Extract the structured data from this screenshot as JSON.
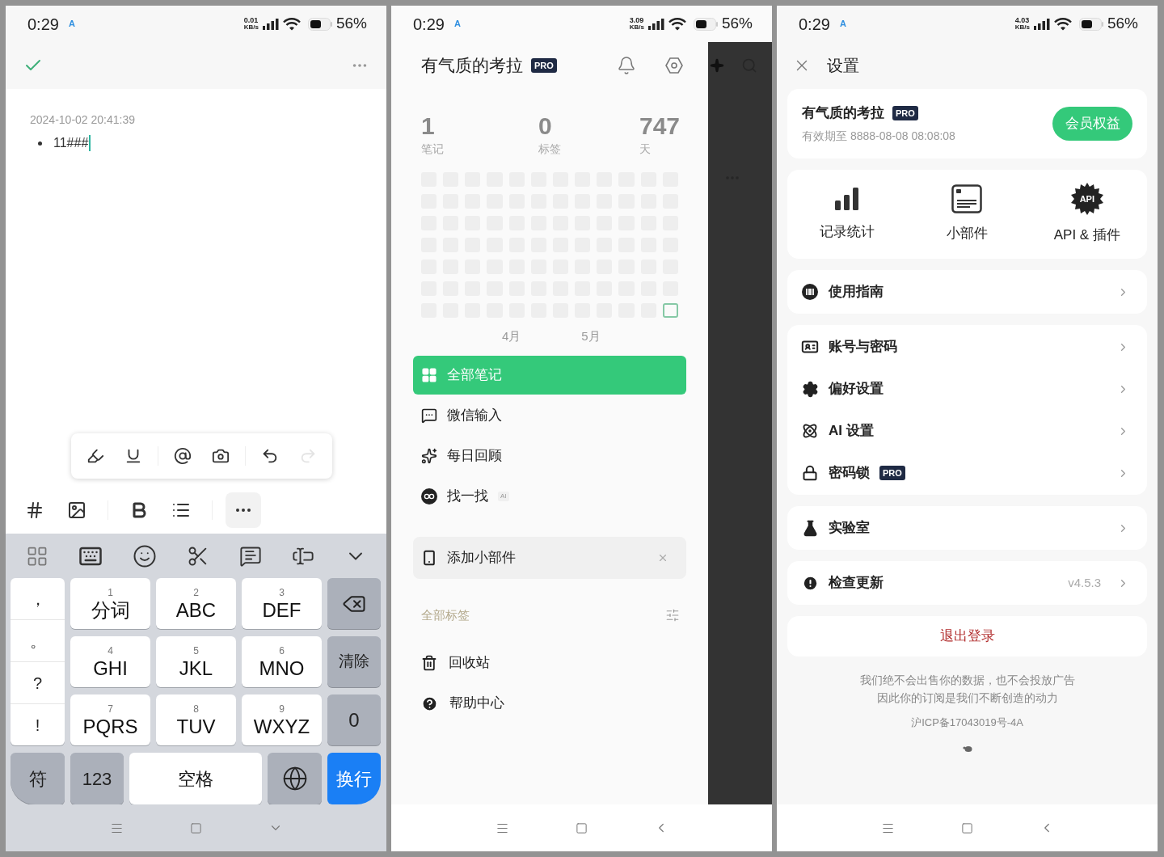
{
  "editor_screen": {
    "status_bar": {
      "time": "0:29",
      "notification": "A",
      "net_speed": "0.01",
      "net_unit": "KB/s",
      "battery": "56%"
    },
    "note": {
      "timestamp": "2024-10-02 20:41:39",
      "bullets": [
        "11###"
      ]
    },
    "floating_toolbar": [
      {
        "kind": "highlight",
        "disabled": false
      },
      {
        "kind": "underline",
        "disabled": false
      },
      {
        "kind": "mention",
        "disabled": false
      },
      {
        "kind": "camera",
        "disabled": false
      },
      {
        "kind": "undo",
        "disabled": false
      },
      {
        "kind": "redo",
        "disabled": true
      }
    ],
    "format_toolbar": [
      {
        "kind": "tag",
        "selected": false
      },
      {
        "kind": "image",
        "selected": false
      },
      {
        "kind": "bold",
        "selected": false
      },
      {
        "kind": "list",
        "selected": false
      },
      {
        "kind": "more",
        "selected": true
      }
    ],
    "keyboard": {
      "punctuation": [
        "，",
        "。",
        "?",
        "!"
      ],
      "keys": [
        {
          "digit": "1",
          "letters": "分词"
        },
        {
          "digit": "2",
          "letters": "ABC"
        },
        {
          "digit": "3",
          "letters": "DEF"
        },
        {
          "digit": "4",
          "letters": "GHI"
        },
        {
          "digit": "5",
          "letters": "JKL"
        },
        {
          "digit": "6",
          "letters": "MNO"
        },
        {
          "digit": "7",
          "letters": "PQRS"
        },
        {
          "digit": "8",
          "letters": "TUV"
        },
        {
          "digit": "9",
          "letters": "WXYZ"
        }
      ],
      "side_keys": [
        {
          "kind": "backspace"
        },
        {
          "kind": "text",
          "label": "清除"
        },
        {
          "kind": "text",
          "label": "0"
        }
      ],
      "bottom_row": [
        {
          "kind": "symbol",
          "label": "符"
        },
        {
          "kind": "function",
          "label": "123"
        },
        {
          "kind": "space",
          "label": "空格"
        },
        {
          "kind": "globe"
        },
        {
          "kind": "enter",
          "label": "换行"
        }
      ]
    }
  },
  "drawer_screen": {
    "status_bar": {
      "time": "0:29",
      "notification": "A",
      "net_speed": "3.09",
      "net_unit": "KB/s",
      "battery": "56%"
    },
    "profile": {
      "name": "有气质的考拉",
      "badge": "PRO"
    },
    "stats": [
      {
        "value": "1",
        "label": "笔记"
      },
      {
        "value": "0",
        "label": "标签"
      },
      {
        "value": "747",
        "label": "天"
      }
    ],
    "heatmap": {
      "rows": [
        [
          {
            "today": false
          },
          {
            "today": false
          },
          {
            "today": false
          },
          {
            "today": false
          },
          {
            "today": false
          },
          {
            "today": false
          },
          {
            "today": false
          },
          {
            "today": false
          },
          {
            "today": false
          },
          {
            "today": false
          },
          {
            "today": false
          },
          {
            "today": false
          }
        ],
        [
          {
            "today": false
          },
          {
            "today": false
          },
          {
            "today": false
          },
          {
            "today": false
          },
          {
            "today": false
          },
          {
            "today": false
          },
          {
            "today": false
          },
          {
            "today": false
          },
          {
            "today": false
          },
          {
            "today": false
          },
          {
            "today": false
          },
          {
            "today": false
          }
        ],
        [
          {
            "today": false
          },
          {
            "today": false
          },
          {
            "today": false
          },
          {
            "today": false
          },
          {
            "today": false
          },
          {
            "today": false
          },
          {
            "today": false
          },
          {
            "today": false
          },
          {
            "today": false
          },
          {
            "today": false
          },
          {
            "today": false
          },
          {
            "today": false
          }
        ],
        [
          {
            "today": false
          },
          {
            "today": false
          },
          {
            "today": false
          },
          {
            "today": false
          },
          {
            "today": false
          },
          {
            "today": false
          },
          {
            "today": false
          },
          {
            "today": false
          },
          {
            "today": false
          },
          {
            "today": false
          },
          {
            "today": false
          },
          {
            "today": false
          }
        ],
        [
          {
            "today": false
          },
          {
            "today": false
          },
          {
            "today": false
          },
          {
            "today": false
          },
          {
            "today": false
          },
          {
            "today": false
          },
          {
            "today": false
          },
          {
            "today": false
          },
          {
            "today": false
          },
          {
            "today": false
          },
          {
            "today": false
          },
          {
            "today": false
          }
        ],
        [
          {
            "today": false
          },
          {
            "today": false
          },
          {
            "today": false
          },
          {
            "today": false
          },
          {
            "today": false
          },
          {
            "today": false
          },
          {
            "today": false
          },
          {
            "today": false
          },
          {
            "today": false
          },
          {
            "today": false
          },
          {
            "today": false
          },
          {
            "today": false
          }
        ],
        [
          {
            "today": false
          },
          {
            "today": false
          },
          {
            "today": false
          },
          {
            "today": false
          },
          {
            "today": false
          },
          {
            "today": false
          },
          {
            "today": false
          },
          {
            "today": false
          },
          {
            "today": false
          },
          {
            "today": false
          },
          {
            "today": false
          },
          {
            "today": true
          }
        ]
      ],
      "months": [
        "4月",
        "5月"
      ]
    },
    "nav": [
      {
        "label": "全部笔记",
        "selected": true
      },
      {
        "label": "微信输入",
        "selected": false
      },
      {
        "label": "每日回顾",
        "selected": false
      },
      {
        "label": "找一找",
        "badge": "AI",
        "selected": false
      }
    ],
    "widget_card": {
      "label": "添加小部件"
    },
    "tags_section": {
      "title": "全部标签"
    },
    "footer_nav": [
      {
        "label": "回收站"
      },
      {
        "label": "帮助中心"
      }
    ]
  },
  "settings_screen": {
    "status_bar": {
      "time": "0:29",
      "notification": "A",
      "net_speed": "4.03",
      "net_unit": "KB/s",
      "battery": "56%"
    },
    "title": "设置",
    "account": {
      "name": "有气质的考拉",
      "badge": "PRO",
      "expiry": "有效期至 8888-08-08 08:08:08",
      "button": "会员权益"
    },
    "shortcuts": [
      {
        "label": "记录统计"
      },
      {
        "label": "小部件"
      },
      {
        "label": "API & 插件",
        "icon_text": "API"
      }
    ],
    "groups": [
      [
        {
          "label": "使用指南"
        }
      ],
      [
        {
          "label": "账号与密码"
        },
        {
          "label": "偏好设置"
        },
        {
          "label": "AI 设置"
        },
        {
          "label": "密码锁",
          "badge": "PRO"
        }
      ],
      [
        {
          "label": "实验室"
        }
      ],
      [
        {
          "label": "检查更新",
          "value": "v4.5.3"
        }
      ]
    ],
    "logout": "退出登录",
    "footer": [
      "我们绝不会出售你的数据，也不会投放广告",
      "因此你的订阅是我们不断创造的动力"
    ],
    "icp": "沪ICP备17043019号-4A"
  }
}
